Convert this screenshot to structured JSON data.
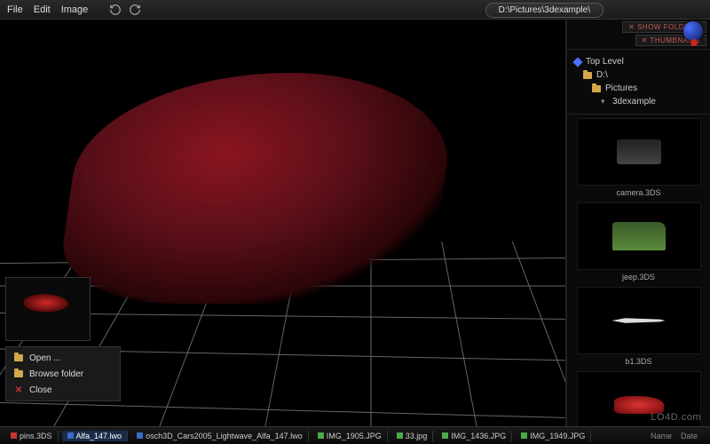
{
  "menu": {
    "file": "File",
    "edit": "Edit",
    "image": "Image"
  },
  "path": "D:\\Pictures\\3dexample\\",
  "side_tabs": {
    "folders": "SHOW FOLDERS",
    "thumbs": "THUMBNAILS"
  },
  "tree": {
    "top": "Top Level",
    "drive": "D:\\",
    "folder": "Pictures",
    "sub": "3dexample"
  },
  "thumbs": [
    {
      "label": "camera.3DS"
    },
    {
      "label": "jeep.3DS"
    },
    {
      "label": "b1.3DS"
    },
    {
      "label": ""
    }
  ],
  "context": {
    "open": "Open ...",
    "browse": "Browse folder",
    "close": "Close"
  },
  "status_files": [
    {
      "name": "pins.3DS",
      "color": "red",
      "active": false
    },
    {
      "name": "Alfa_147.lwo",
      "color": "blue",
      "active": true
    },
    {
      "name": "osch3D_Cars2005_Lightwave_Alfa_147.lwo",
      "color": "blue",
      "active": false
    },
    {
      "name": "IMG_1905.JPG",
      "color": "green",
      "active": false
    },
    {
      "name": "33.jpg",
      "color": "green",
      "active": false
    },
    {
      "name": "IMG_1436.JPG",
      "color": "green",
      "active": false
    },
    {
      "name": "IMG_1949.JPG",
      "color": "green",
      "active": false
    }
  ],
  "status_right": {
    "name": "Name",
    "date": "Date"
  },
  "watermark": "LO4D.com"
}
